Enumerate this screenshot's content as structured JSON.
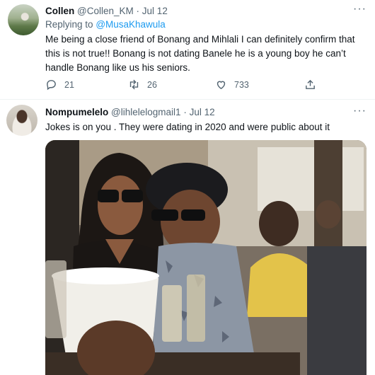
{
  "tweets": [
    {
      "name": "Collen",
      "handle": "@Collen_KM",
      "separator": "·",
      "date": "Jul 12",
      "replying_prefix": "Replying to",
      "replying_to": "@MusaKhawula",
      "text_lines": [
        "Me being a close friend of Bonang and Mihlali I can definitely confirm that",
        "this is not true!! Bonang is not dating Banele he is a young boy he can’t",
        "handle Bonang like us his seniors."
      ],
      "replies": "21",
      "retweets": "26",
      "likes": "733",
      "more": "···"
    },
    {
      "name": "Nompumelelo",
      "handle": "@lihlelelogmail1",
      "separator": "·",
      "date": "Jul 12",
      "text": "Jokes is on you . They were dating in 2020 and were public about it",
      "more": "···"
    }
  ],
  "colors": {
    "accent": "#1d9bf0",
    "secondary_text": "#536471",
    "primary_text": "#0f1419"
  },
  "icons": [
    "reply-icon",
    "retweet-icon",
    "like-icon",
    "share-icon",
    "more-icon"
  ]
}
